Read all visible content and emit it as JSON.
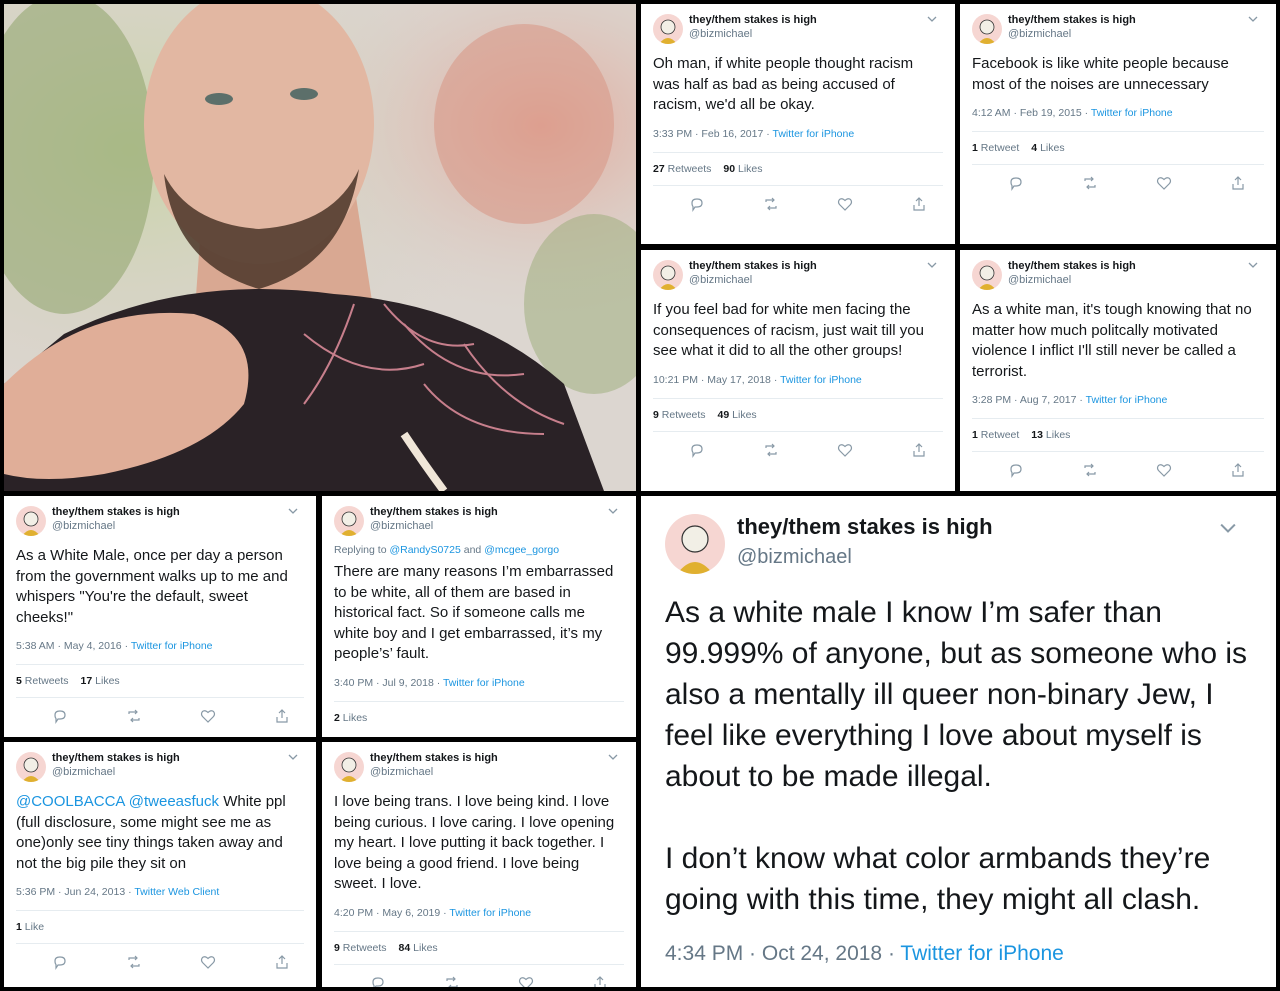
{
  "author": {
    "display_name": "they/them stakes is high",
    "handle": "@bizmichael"
  },
  "photo": {
    "description_icon": "portrait-photo"
  },
  "tweets": [
    {
      "text": "Oh man, if white people thought racism was half as bad as being accused of racism, we'd all be okay.",
      "time": "3:33 PM · Feb 16, 2017",
      "source": "Twitter for iPhone",
      "retweets_num": "27",
      "retweets_label": "Retweets",
      "likes_num": "90",
      "likes_label": "Likes"
    },
    {
      "text": "Facebook is like white people because most of the noises are unnecessary",
      "time": "4:12 AM · Feb 19, 2015",
      "source": "Twitter for iPhone",
      "retweets_num": "1",
      "retweets_label": "Retweet",
      "likes_num": "4",
      "likes_label": "Likes"
    },
    {
      "text": "If you feel bad for white men facing the consequences of racism, just wait till you see what it did to all the other groups!",
      "time": "10:21 PM · May 17, 2018",
      "source": "Twitter for iPhone",
      "retweets_num": "9",
      "retweets_label": "Retweets",
      "likes_num": "49",
      "likes_label": "Likes"
    },
    {
      "text": "As a white man, it's tough knowing that no matter how much politcally motivated violence I inflict I'll still never be called a terrorist.",
      "time": "3:28 PM · Aug 7, 2017",
      "source": "Twitter for iPhone",
      "retweets_num": "1",
      "retweets_label": "Retweet",
      "likes_num": "13",
      "likes_label": "Likes"
    },
    {
      "text": "As a White Male, once per day a person from the government walks up to me and whispers \"You're the default, sweet cheeks!\"",
      "time": "5:38 AM · May 4, 2016",
      "source": "Twitter for iPhone",
      "retweets_num": "5",
      "retweets_label": "Retweets",
      "likes_num": "17",
      "likes_label": "Likes"
    },
    {
      "reply_prefix": "Replying to",
      "reply_user1": "@RandyS0725",
      "reply_and": "and",
      "reply_user2": "@mcgee_gorgo",
      "text": "There are many reasons I’m embarrassed to be white, all of them are based in historical fact. So if someone calls me white boy and I get embarrassed, it’s my people’s’ fault.",
      "time": "3:40 PM · Jul 9, 2018",
      "source": "Twitter for iPhone",
      "likes_num": "2",
      "likes_label": "Likes"
    },
    {
      "mention1": "@COOLBACCA",
      "mention2": "@tweeasfuck",
      "text": " White ppl (full disclosure, some might see me as one)only see tiny things taken away and not the big pile they sit on",
      "time": "5:36 PM · Jun 24, 2013",
      "source": "Twitter Web Client",
      "likes_num": "1",
      "likes_label": "Like"
    },
    {
      "text": "I love being trans. I love being kind. I love being curious. I love caring. I love opening my heart. I love putting it back together. I love being a good friend. I love being sweet. I love.",
      "time": "4:20 PM · May 6, 2019",
      "source": "Twitter for iPhone",
      "retweets_num": "9",
      "retweets_label": "Retweets",
      "likes_num": "84",
      "likes_label": "Likes"
    },
    {
      "text": "As a white male I know I’m safer than 99.999% of anyone, but as someone who is also a mentally ill queer non-binary Jew, I feel like everything I love about myself is about to be made illegal.\n\nI don’t know what color armbands they’re going with this time, they might all clash.",
      "time": "4:34 PM · Oct 24, 2018",
      "source": "Twitter for iPhone"
    }
  ],
  "sep": " · ",
  "colors": {
    "link": "#1b95e0",
    "text": "#14171a",
    "muted": "#657786"
  },
  "icons": [
    "reply-icon",
    "retweet-icon",
    "like-icon",
    "share-icon",
    "chevron-down-icon"
  ]
}
